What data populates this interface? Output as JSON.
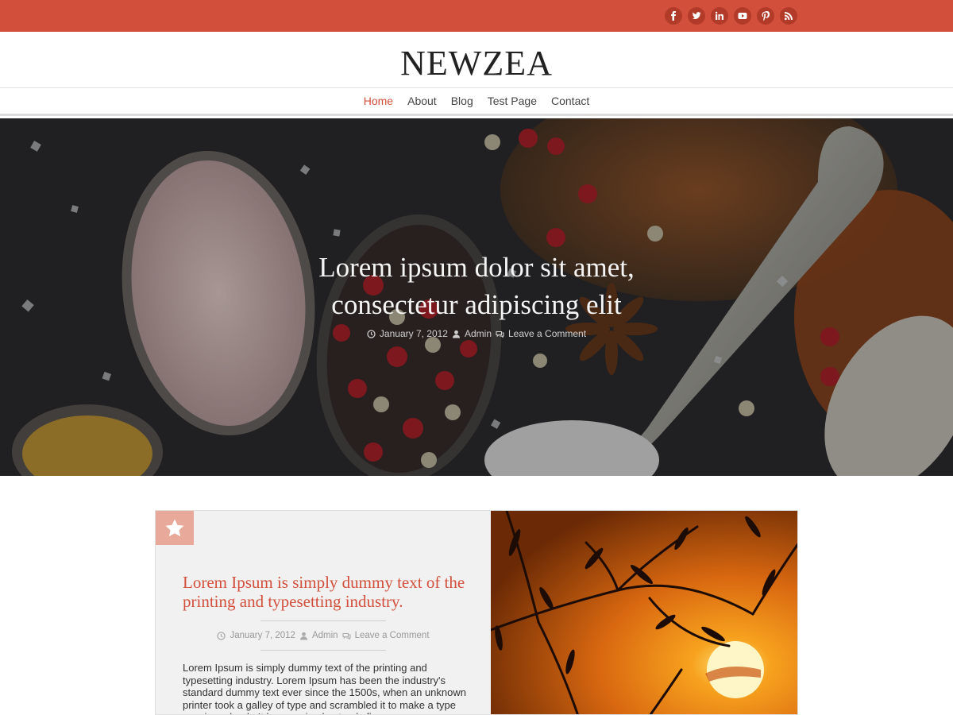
{
  "topbar": {
    "accent_color": "#d24f3b",
    "social_icons": [
      "facebook-icon",
      "twitter-icon",
      "linkedin-icon",
      "youtube-icon",
      "pinterest-icon",
      "rss-icon"
    ]
  },
  "site": {
    "title": "NEWZEA"
  },
  "nav": {
    "items": [
      {
        "label": "Home",
        "active": true
      },
      {
        "label": "About",
        "active": false
      },
      {
        "label": "Blog",
        "active": false
      },
      {
        "label": "Test Page",
        "active": false
      },
      {
        "label": "Contact",
        "active": false
      }
    ]
  },
  "hero": {
    "title_line1": "Lorem ipsum dolor sit amet,",
    "title_line2": "consectetur adipiscing elit",
    "meta": {
      "date": "January 7, 2012",
      "author": "Admin",
      "comments": "Leave a Comment"
    }
  },
  "post": {
    "badge_icon": "star-icon",
    "title": "Lorem Ipsum is simply dummy text of the printing and typesetting industry.",
    "meta": {
      "date": "January 7, 2012",
      "author": "Admin",
      "comments": "Leave a Comment"
    },
    "excerpt": "Lorem Ipsum is simply dummy text of the printing and typesetting industry. Lorem Ipsum has been the industry's standard dummy text ever since the 1500s, when an unknown printer took a galley of type and scrambled it to make a type specimen book. It has survived not only five"
  }
}
